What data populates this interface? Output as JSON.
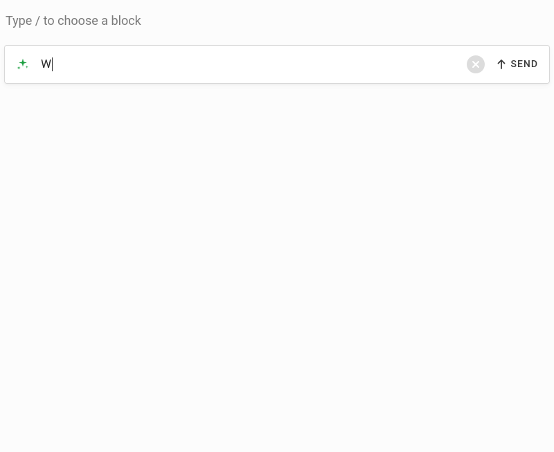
{
  "page": {
    "hint_text": "Type / to choose a block"
  },
  "input": {
    "value": "W",
    "icon_name": "sparkle"
  },
  "actions": {
    "clear_icon": "close",
    "send_label": "SEND",
    "send_icon": "arrow-up"
  },
  "colors": {
    "accent_green": "#1a9e3f",
    "clear_bg": "#dcdcdc",
    "text_muted": "#7a7a7a"
  }
}
